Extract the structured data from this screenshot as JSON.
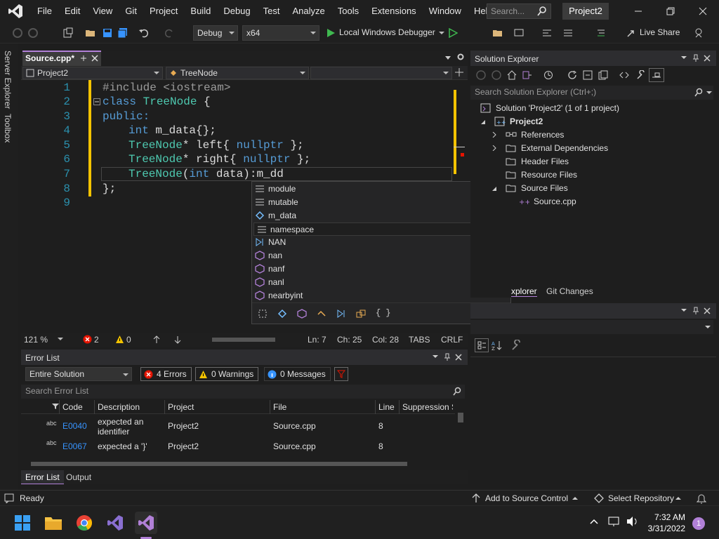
{
  "menu": [
    "File",
    "Edit",
    "View",
    "Git",
    "Project",
    "Build",
    "Debug",
    "Test",
    "Analyze",
    "Tools",
    "Extensions",
    "Window",
    "Help"
  ],
  "search": {
    "placeholder": "Search..."
  },
  "project_badge": "Project2",
  "toolbar": {
    "config": "Debug",
    "platform": "x64",
    "run_label": "Local Windows Debugger",
    "live_share": "Live Share"
  },
  "left_strip": [
    "Server Explorer",
    "Toolbox"
  ],
  "editor": {
    "tab_label": "Source.cpp*",
    "nav_project": "Project2",
    "nav_scope": "TreeNode",
    "lines": [
      {
        "n": "1"
      },
      {
        "n": "2"
      },
      {
        "n": "3"
      },
      {
        "n": "4"
      },
      {
        "n": "5"
      },
      {
        "n": "6"
      },
      {
        "n": "7"
      },
      {
        "n": "8"
      },
      {
        "n": "9"
      }
    ],
    "code": {
      "l1_pp": "#include <iostream>",
      "l2_kw": "class",
      "l2_ty": "TreeNode",
      "l2_rest": " {",
      "l3_kw": "public:",
      "l4_kw": "int",
      "l4_rest": " m_data{};",
      "l5_ty": "TreeNode",
      "l5_rest": "* left{ ",
      "l5_kw": "nullptr",
      "l5_end": " };",
      "l6_ty": "TreeNode",
      "l6_rest": "* right{ ",
      "l6_kw": "nullptr",
      "l6_end": " };",
      "l7_ty": "TreeNode",
      "l7_a": "(",
      "l7_kw": "int",
      "l7_b": " data):m_dd",
      "l8": "};"
    }
  },
  "intellisense": {
    "items": [
      "module",
      "mutable",
      "m_data",
      "namespace",
      "NAN",
      "nan",
      "nanf",
      "nanl",
      "nearbyint"
    ],
    "filter_braces": "{ }"
  },
  "editor_status": {
    "zoom": "121 %",
    "errors": "2",
    "warnings": "0",
    "ln": "Ln: 7",
    "ch": "Ch: 25",
    "col": "Col: 28",
    "tabs": "TABS",
    "crlf": "CRLF"
  },
  "error_list": {
    "title": "Error List",
    "scope": "Entire Solution",
    "errors_btn": "4 Errors",
    "warnings_btn": "0 Warnings",
    "messages_btn": "0 Messages",
    "search_placeholder": "Search Error List",
    "columns": [
      "Code",
      "Description",
      "Project",
      "File",
      "Line",
      "Suppression S"
    ],
    "rows": [
      {
        "code": "E0040",
        "desc1": "expected an",
        "desc2": "identifier",
        "project": "Project2",
        "file": "Source.cpp",
        "line": "8"
      },
      {
        "code": "E0067",
        "desc1": "expected a '}'",
        "desc2": "",
        "project": "Project2",
        "file": "Source.cpp",
        "line": "8"
      }
    ],
    "tabs": [
      "Error List",
      "Output"
    ]
  },
  "solution_explorer": {
    "title": "Solution Explorer",
    "search_placeholder": "Search Solution Explorer (Ctrl+;)",
    "solution": "Solution 'Project2' (1 of 1 project)",
    "project": "Project2",
    "items": [
      "References",
      "External Dependencies",
      "Header Files",
      "Resource Files",
      "Source Files"
    ],
    "file": "Source.cpp",
    "tabs": [
      "xplorer",
      "Git Changes"
    ]
  },
  "statusbar": {
    "ready": "Ready",
    "source_control": "Add to Source Control",
    "repo": "Select Repository"
  },
  "taskbar": {
    "time": "7:32 AM",
    "date": "3/31/2022",
    "notifications": "1"
  },
  "colors": {
    "accent": "#b180d7",
    "keyword": "#569cd6",
    "type": "#4ec9b0",
    "error": "#e51400",
    "warning": "#f3c300"
  }
}
